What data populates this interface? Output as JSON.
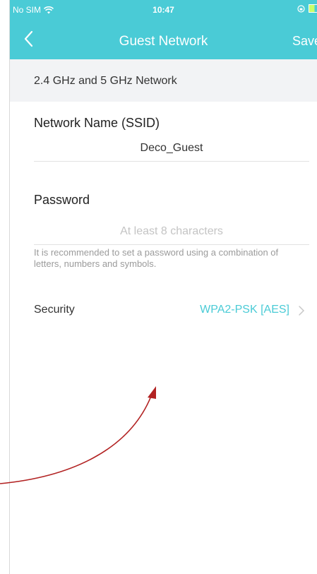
{
  "status_bar": {
    "carrier": "No SIM",
    "time": "10:47"
  },
  "nav": {
    "title": "Guest Network",
    "save_label": "Save"
  },
  "section": {
    "header": "2.4 GHz and 5 GHz Network"
  },
  "ssid": {
    "label": "Network Name (SSID)",
    "value": "Deco_Guest"
  },
  "password": {
    "label": "Password",
    "placeholder": "At least 8 characters",
    "hint": "It is recommended to set a password using a combination of letters, numbers and symbols."
  },
  "security": {
    "label": "Security",
    "value": "WPA2-PSK [AES]"
  },
  "colors": {
    "accent": "#4acbd6",
    "annotation_arrow": "#b22222"
  },
  "icons": [
    "wifi-icon",
    "rotation-lock-icon",
    "battery-icon",
    "back-arrow-icon",
    "chevron-right-icon",
    "annotation-arrow"
  ]
}
